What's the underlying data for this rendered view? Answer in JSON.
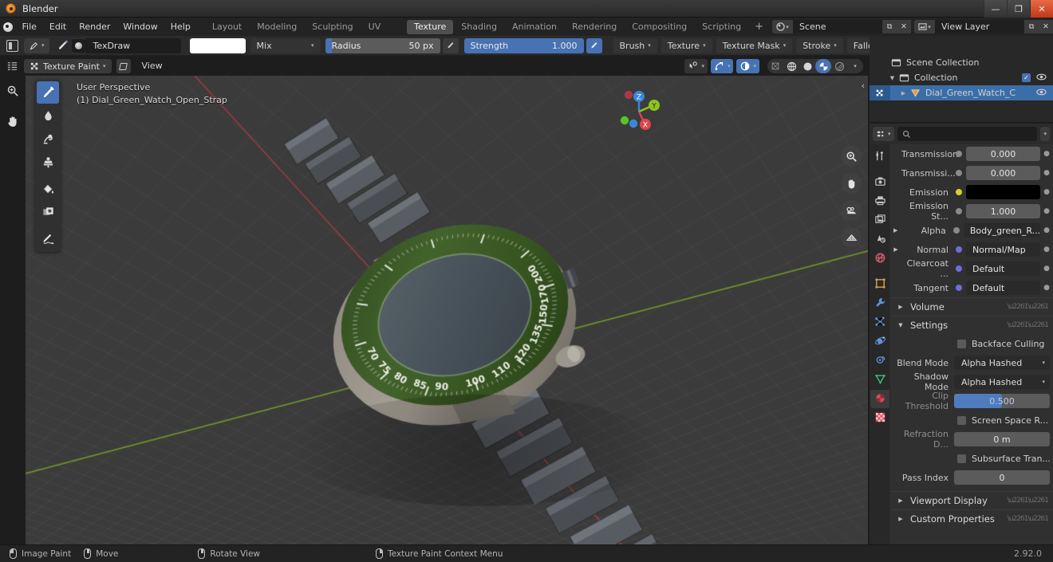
{
  "window": {
    "title": "Blender",
    "buttons": {
      "minimize": "—",
      "maximize": "❐",
      "close": "✕"
    }
  },
  "menu": {
    "items": [
      "File",
      "Edit",
      "Render",
      "Window",
      "Help"
    ]
  },
  "workspaces": {
    "tabs": [
      "Layout",
      "Modeling",
      "Sculpting",
      "UV Editing",
      "Texture Paint",
      "Shading",
      "Animation",
      "Rendering",
      "Compositing",
      "Scripting"
    ],
    "active": "Texture Paint",
    "add_label": "+"
  },
  "topbar": {
    "scene_name": "Scene",
    "view_layer_name": "View Layer",
    "new_scene_label": "⧉",
    "remove_scene_label": "✕"
  },
  "tool_header": {
    "brush_name": "TexDraw",
    "color_value": "#ffffff",
    "blend_mode": "Mix",
    "radius_label": "Radius",
    "radius_value": "50 px",
    "strength_label": "Strength",
    "strength_value": "1.000",
    "popovers": [
      "Brush",
      "Texture",
      "Texture Mask",
      "Stroke",
      "Falloff"
    ],
    "radius_fill_pct": 6,
    "strength_fill_pct": 100
  },
  "viewport_header": {
    "mode": "Texture Paint",
    "view_menu": "View",
    "overlay_icons": [
      "gizmo-eye-icon",
      "overlays-icon",
      "xray-icon"
    ],
    "shading_modes": [
      "wireframe",
      "solid",
      "material",
      "rendered"
    ],
    "shading_active": "material"
  },
  "viewport": {
    "perspective_label": "User Perspective",
    "object_label": "(1) Dial_Green_Watch_Open_Strap",
    "gizmo_axes": [
      {
        "name": "Z",
        "label": "Z",
        "color": "#3a86d8"
      },
      {
        "name": "Y",
        "label": "Y",
        "color": "#8fc31f"
      },
      {
        "name": "X",
        "label": "X",
        "color": "#e0444b"
      }
    ],
    "nav_buttons": [
      "zoom-icon",
      "pan-hand-icon",
      "camera-view-icon",
      "toggle-ortho-grid-icon"
    ],
    "tools": [
      {
        "name": "draw-tool",
        "icon": "paint-brush-icon",
        "active": true
      },
      {
        "name": "soften-tool",
        "icon": "droplet-icon",
        "active": false
      },
      {
        "name": "smear-tool",
        "icon": "smear-icon",
        "active": false
      },
      {
        "name": "clone-tool",
        "icon": "stamp-icon",
        "active": false
      },
      {
        "name": "fill-tool",
        "icon": "paint-bucket-icon",
        "active": false
      },
      {
        "name": "mask-tool",
        "icon": "mask-icon",
        "active": false
      },
      {
        "name": "annotate-tool",
        "icon": "pencil-icon",
        "active": false
      }
    ],
    "left_strip_tools": [
      "cursor-zoom-icon",
      "hand-icon"
    ],
    "bezel_numbers": [
      "100",
      "110",
      "120",
      "135",
      "150",
      "170",
      "200",
      "90",
      "85",
      "80",
      "75",
      "70"
    ]
  },
  "outliner": {
    "display_mode_icon": "outliner-icon",
    "filter_icon": "filter-icon",
    "search_placeholder": "",
    "rows": [
      {
        "name": "scene-collection",
        "label": "Scene Collection",
        "indent": 6,
        "icon": "collection-icon",
        "disclosure": "",
        "selected": false,
        "checkbox": false,
        "eye": false
      },
      {
        "name": "collection",
        "label": "Collection",
        "indent": 16,
        "icon": "collection-icon",
        "disclosure": "▼",
        "selected": false,
        "checkbox": true,
        "eye": true
      },
      {
        "name": "object-dial-green-watch",
        "label": "Dial_Green_Watch_C",
        "indent": 30,
        "icon": "mesh-data-icon",
        "disclosure": "▶",
        "selected": true,
        "checkbox": false,
        "eye": true
      }
    ]
  },
  "properties": {
    "search_placeholder": "",
    "tabs": [
      {
        "name": "tool-tab",
        "icon": "tool-icon",
        "active": false
      },
      {
        "name": "render-tab",
        "icon": "camera-back-icon",
        "active": false
      },
      {
        "name": "output-tab",
        "icon": "printer-icon",
        "active": false
      },
      {
        "name": "view-layer-tab",
        "icon": "images-icon",
        "active": false
      },
      {
        "name": "scene-tab",
        "icon": "scene-cone-icon",
        "active": false
      },
      {
        "name": "world-tab",
        "icon": "world-globe-icon",
        "active": false
      },
      {
        "name": "object-tab",
        "icon": "object-square-icon",
        "active": false
      },
      {
        "name": "modifier-tab",
        "icon": "wrench-icon",
        "active": false
      },
      {
        "name": "particles-tab",
        "icon": "particles-icon",
        "active": false
      },
      {
        "name": "physics-tab",
        "icon": "physics-orbit-icon",
        "active": false
      },
      {
        "name": "constraints-tab",
        "icon": "constraints-icon",
        "active": false
      },
      {
        "name": "object-data-tab",
        "icon": "mesh-triangle-icon",
        "active": false
      },
      {
        "name": "material-tab",
        "icon": "material-sphere-icon",
        "active": true
      },
      {
        "name": "texture-tab",
        "icon": "checker-texture-icon",
        "active": false
      }
    ],
    "surface_rows": [
      {
        "name": "transmission",
        "label": "Transmission",
        "value": "0.000",
        "kind": "value",
        "dot": "#8a8a8a"
      },
      {
        "name": "transmission-roughness",
        "label": "Transmissi...",
        "value": "0.000",
        "kind": "value",
        "dot": "#8a8a8a"
      },
      {
        "name": "emission",
        "label": "Emission",
        "value": "",
        "kind": "color",
        "dot": "#d8cf2c"
      },
      {
        "name": "emission-strength",
        "label": "Emission St...",
        "value": "1.000",
        "kind": "value",
        "dot": "#8a8a8a"
      },
      {
        "name": "alpha",
        "label": "Alpha",
        "value": "Body_green_R...",
        "kind": "link",
        "dot": "#8a8a8a",
        "tri": "▶"
      },
      {
        "name": "normal",
        "label": "Normal",
        "value": "Normal/Map",
        "kind": "link",
        "dot": "#6d6ddd",
        "tri": "▶"
      },
      {
        "name": "clearcoat-normal",
        "label": "Clearcoat ...",
        "value": "Default",
        "kind": "link",
        "dot": "#6d6ddd"
      },
      {
        "name": "tangent",
        "label": "Tangent",
        "value": "Default",
        "kind": "link",
        "dot": "#6d6ddd"
      }
    ],
    "panels": [
      {
        "name": "volume-panel",
        "label": "Volume",
        "open": false
      },
      {
        "name": "settings-panel",
        "label": "Settings",
        "open": true
      }
    ],
    "settings": {
      "backface_culling": {
        "label": "Backface Culling",
        "checked": false
      },
      "blend_mode": {
        "label": "Blend Mode",
        "value": "Alpha Hashed"
      },
      "shadow_mode": {
        "label": "Shadow Mode",
        "value": "Alpha Hashed"
      },
      "clip_threshold": {
        "label": "Clip Threshold",
        "value": "0.500",
        "fill_pct": 50
      },
      "screen_space_refraction": {
        "label": "Screen Space R...",
        "checked": false
      },
      "refraction_depth": {
        "label": "Refraction D...",
        "value": "0 m"
      },
      "subsurface_translucency": {
        "label": "Subsurface Tran...",
        "checked": false
      },
      "pass_index": {
        "label": "Pass Index",
        "value": "0"
      }
    },
    "bottom_panels": [
      {
        "name": "viewport-display-panel",
        "label": "Viewport Display",
        "open": false
      },
      {
        "name": "custom-properties-panel",
        "label": "Custom Properties",
        "open": false
      }
    ]
  },
  "status_bar": {
    "items": [
      {
        "name": "status-image-paint",
        "mouse": "l",
        "label": "Image Paint"
      },
      {
        "name": "status-move",
        "mouse": "m",
        "label": "Move"
      },
      {
        "name": "status-rotate-view",
        "mouse": "m",
        "label": "Rotate View"
      },
      {
        "name": "status-context-menu",
        "mouse": "r",
        "label": "Texture Paint Context Menu"
      }
    ],
    "version": "2.92.0"
  },
  "colors": {
    "accent_blue": "#4772b3",
    "bezel_green": "#3d5e2a",
    "viewport_bg": "#3b3b3b",
    "panel_bg": "#303030"
  }
}
